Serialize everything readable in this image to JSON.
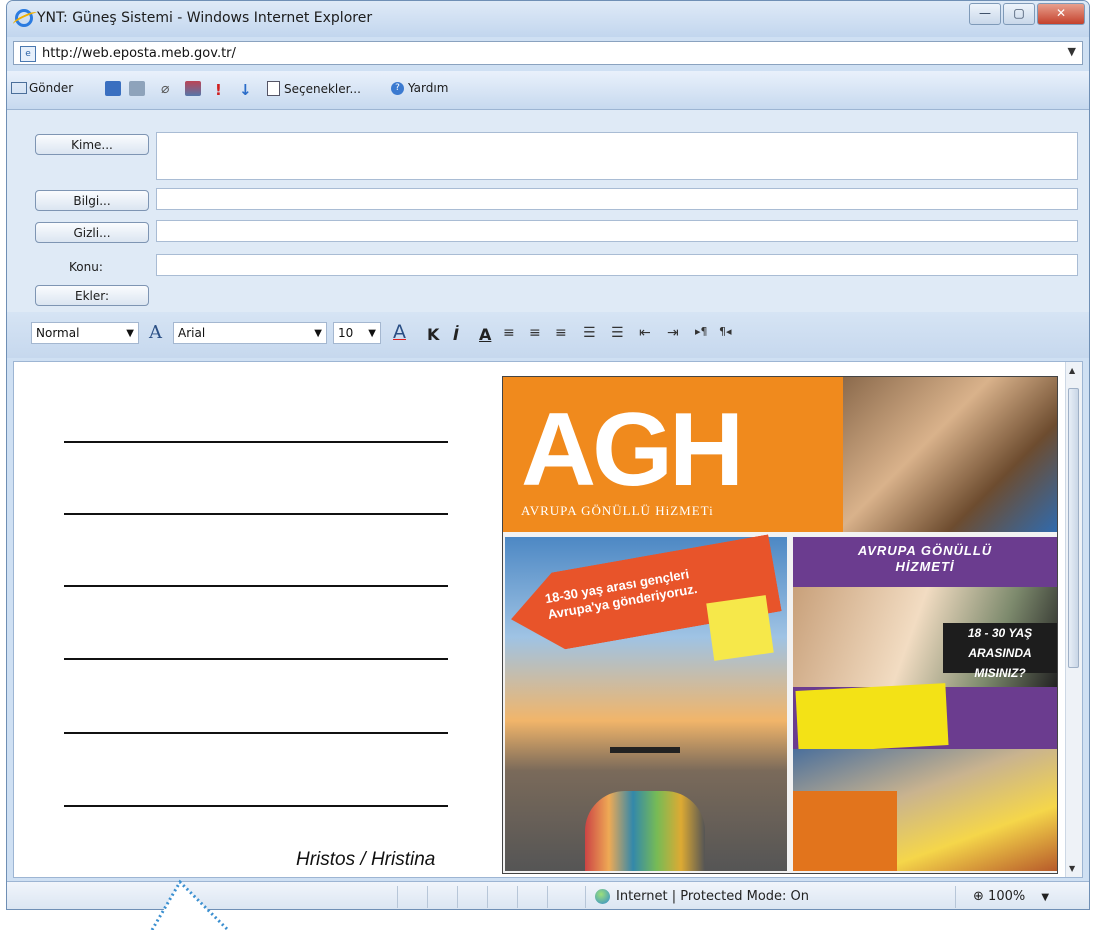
{
  "window": {
    "title": "YNT: Güneş Sistemi - Windows Internet Explorer",
    "minimize": "—",
    "maximize": "▢",
    "close": "✕"
  },
  "address": {
    "url": "http://web.eposta.meb.gov.tr/"
  },
  "toolbar": {
    "send": "Gönder",
    "options": "Seçenekler...",
    "help": "Yardım"
  },
  "compose": {
    "to_label": "Kime...",
    "cc_label": "Bilgi...",
    "bcc_label": "Gizli...",
    "subject_label": "Konu:",
    "attachments_label": "Ekler:"
  },
  "format": {
    "style": "Normal",
    "font": "Arial",
    "size": "10",
    "bold": "K",
    "italic": "İ",
    "underline": "A"
  },
  "body": {
    "signature": "Hristos / Hristina"
  },
  "poster": {
    "logo": "AGH",
    "logo_sub": "AVRUPA GÖNÜLLÜ HiZMETi",
    "arrow_text": "18-30 yaş arası gençleri Avrupa'ya gönderiyoruz.",
    "right_title": "AVRUPA GÖNÜLLÜ HİZMETİ",
    "age_text": "18 - 30 YAŞ ARASINDA MISINIZ?"
  },
  "status": {
    "zone": "Internet | Protected Mode: On",
    "zoom": "100%"
  }
}
